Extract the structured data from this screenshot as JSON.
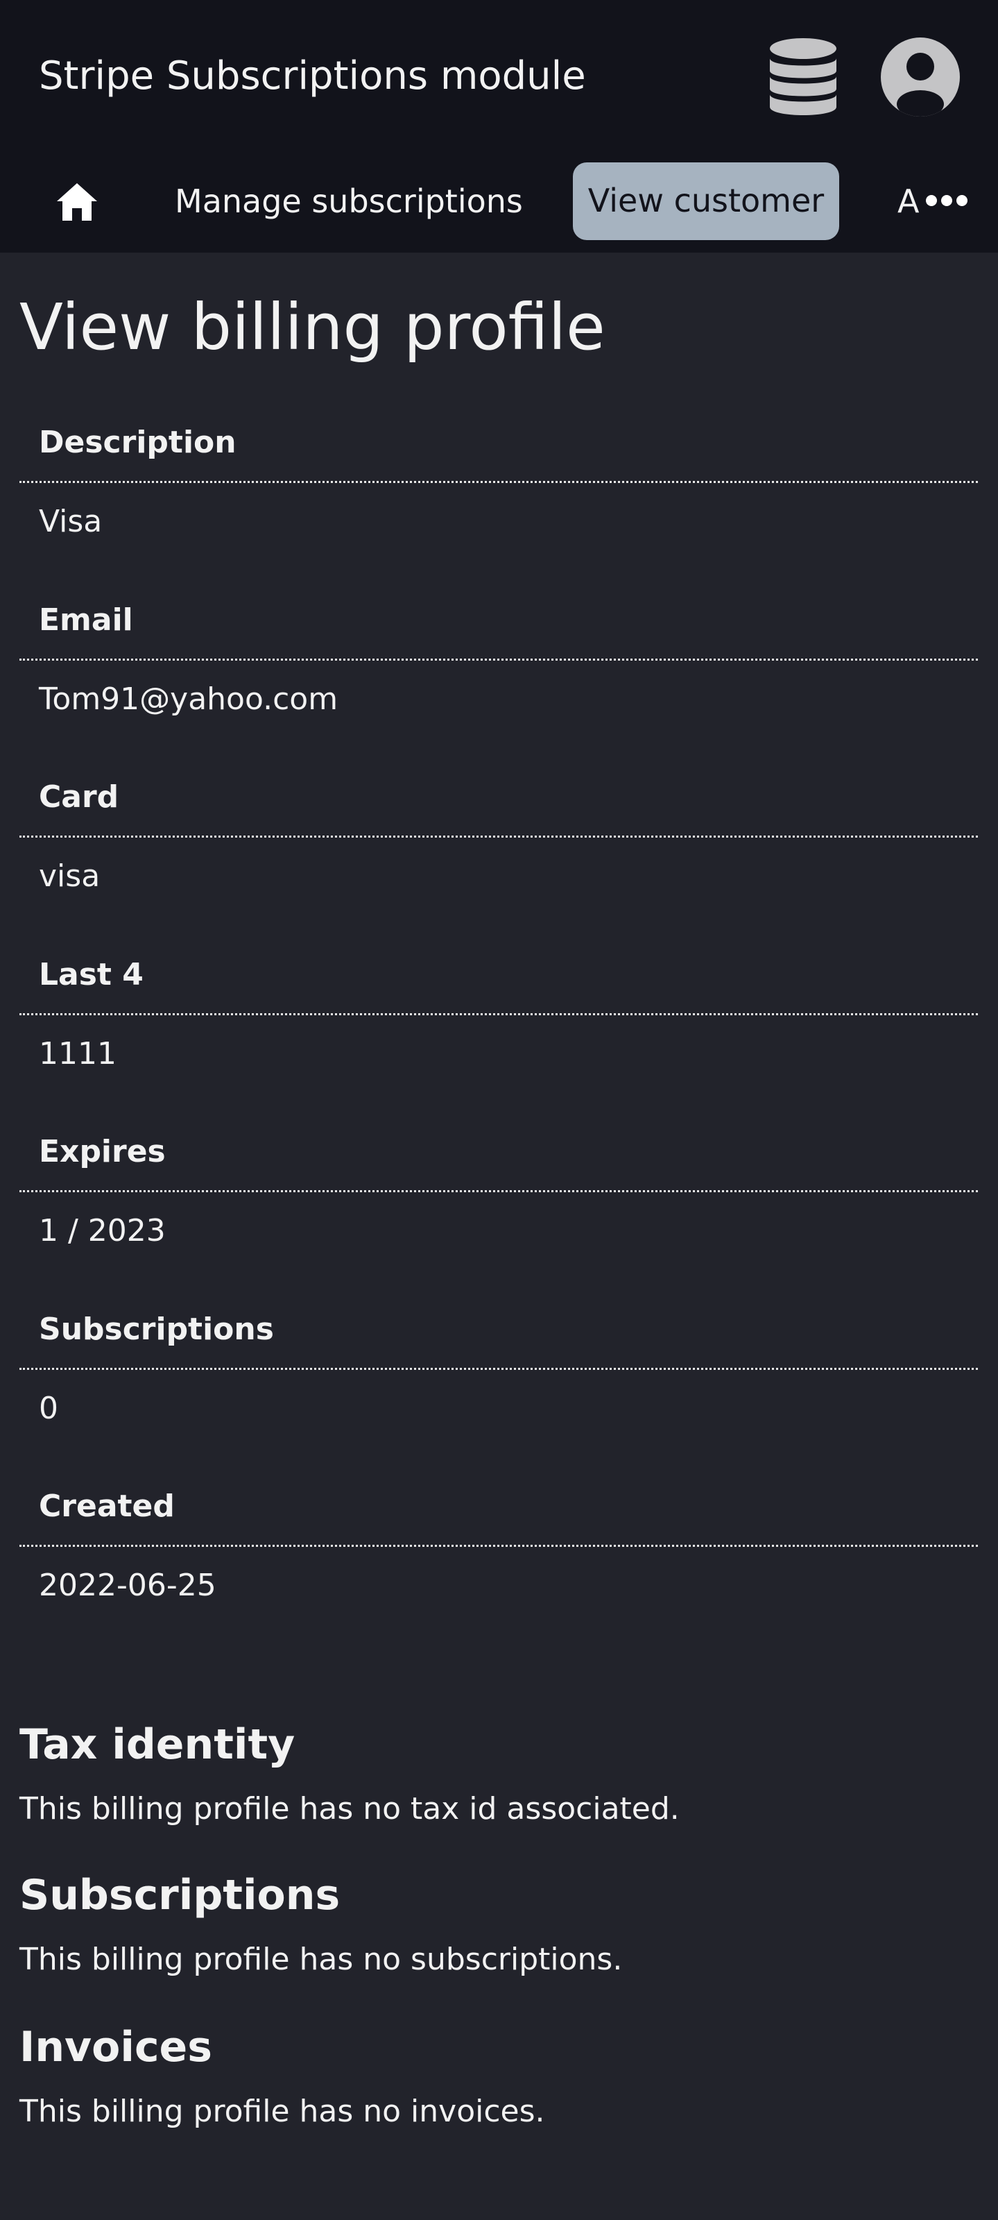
{
  "header": {
    "app_title": "Stripe Subscriptions module",
    "database_icon": "database-icon",
    "user_icon": "user-circle-icon"
  },
  "nav": {
    "home_icon": "home-icon",
    "items": [
      {
        "label": "Manage subscriptions",
        "active": false
      },
      {
        "label": "View customer",
        "active": true
      },
      {
        "label": "A",
        "active": false
      }
    ],
    "more_icon": "ellipsis-icon"
  },
  "page": {
    "title": "View billing profile"
  },
  "fields": [
    {
      "label": "Description",
      "value": "Visa"
    },
    {
      "label": "Email",
      "value": "Tom91@yahoo.com"
    },
    {
      "label": "Card",
      "value": "visa"
    },
    {
      "label": "Last 4",
      "value": "1111"
    },
    {
      "label": "Expires",
      "value": "1 / 2023"
    },
    {
      "label": "Subscriptions",
      "value": "0"
    },
    {
      "label": "Created",
      "value": "2022-06-25"
    }
  ],
  "sections": [
    {
      "heading": "Tax identity",
      "text": "This billing profile has no tax id associated."
    },
    {
      "heading": "Subscriptions",
      "text": "This billing profile has no subscriptions."
    },
    {
      "heading": "Invoices",
      "text": "This billing profile has no invoices."
    }
  ],
  "colors": {
    "page_background": "#22232b",
    "header_background": "#12131b",
    "active_tab_background": "#a6b3c0",
    "icon_gray": "#c4c4c6",
    "text": "#f2f2f2"
  }
}
